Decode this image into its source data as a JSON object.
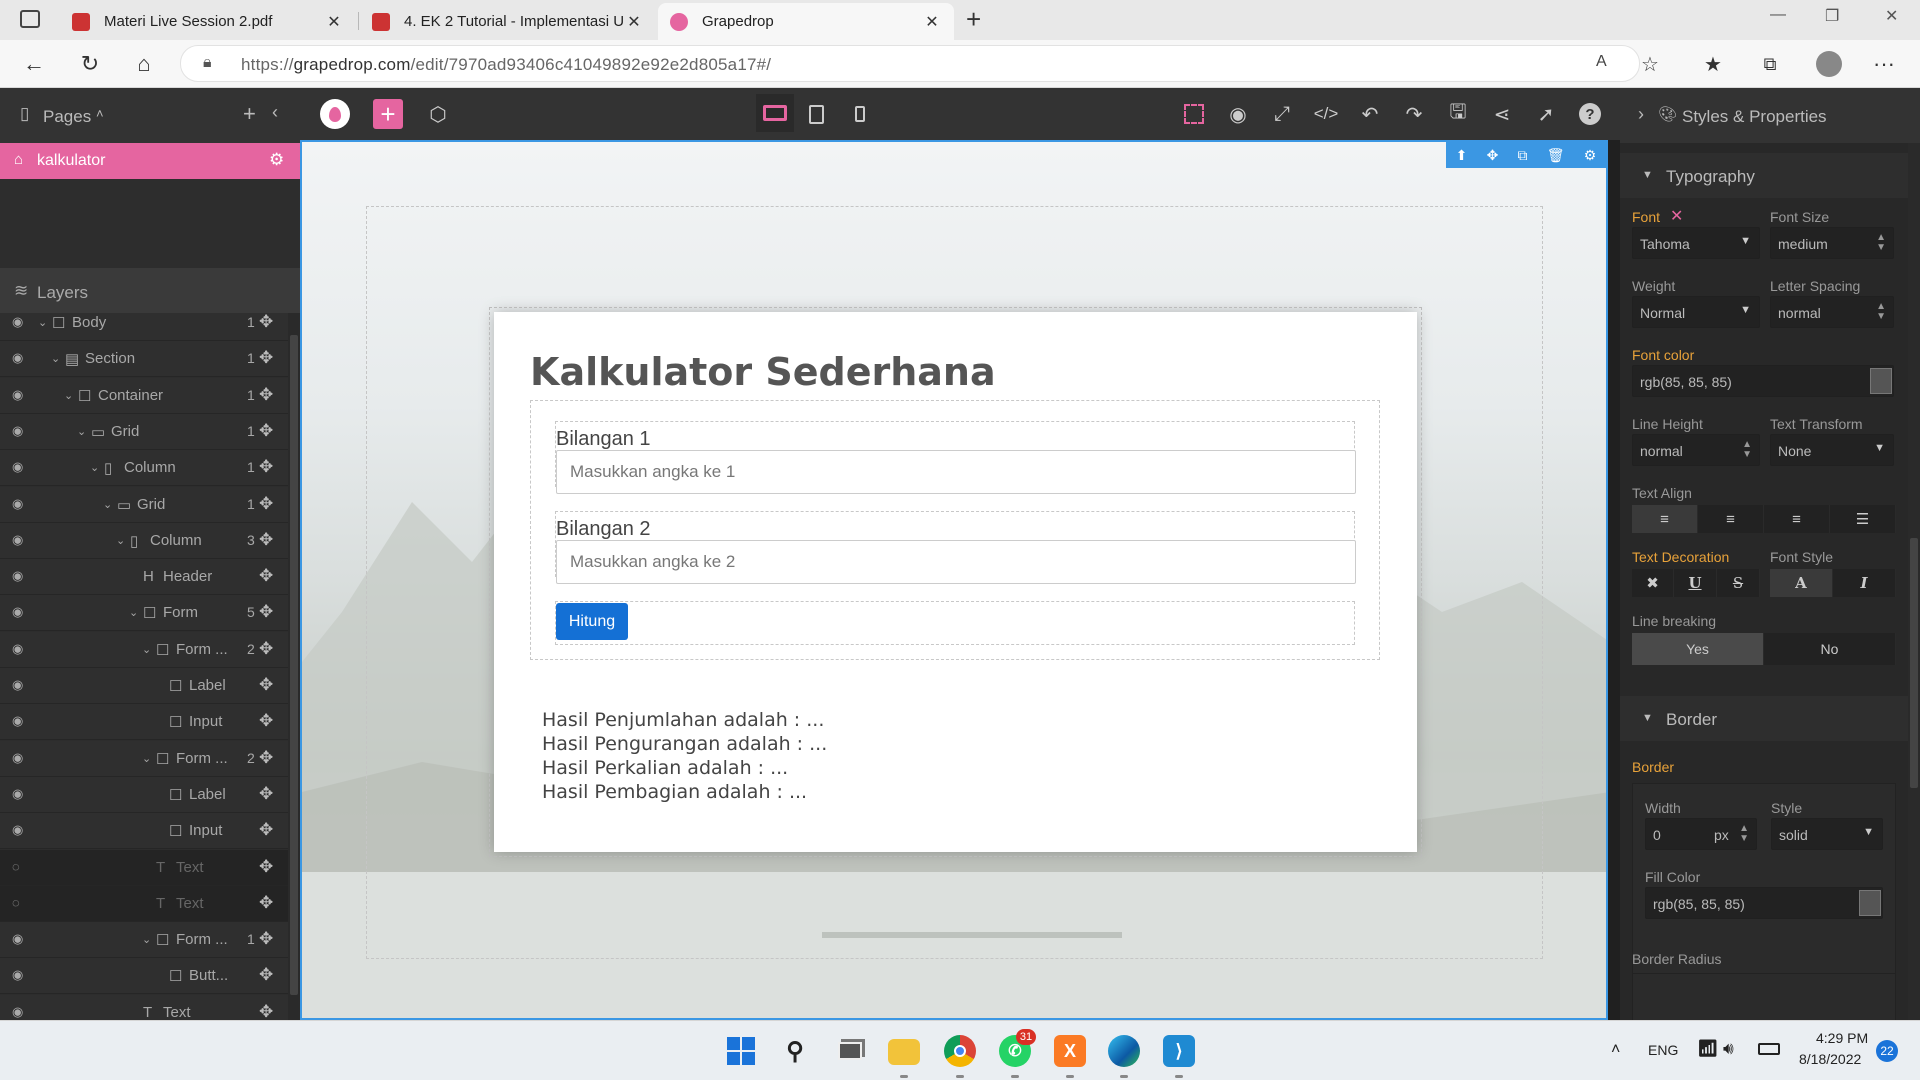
{
  "browser": {
    "tabs": [
      {
        "title": "Materi Live Session 2.pdf",
        "icon": "pdf-icon"
      },
      {
        "title": "4. EK 2 Tutorial - Implementasi U",
        "icon": "pdf-icon"
      },
      {
        "title": "Grapedrop",
        "icon": "grapedrop-icon"
      }
    ],
    "url_prefix": "https://",
    "url_host": "grapedrop.com",
    "url_path": "/edit/7970ad93406c41049892e92e2d805a17#/"
  },
  "left_panel": {
    "pages_label": "Pages",
    "page_name": "kalkulator",
    "layers_label": "Layers",
    "layers": [
      {
        "name": "Body",
        "count": "1",
        "indent": 0,
        "icon": "box-icon",
        "caret": true
      },
      {
        "name": "Section",
        "count": "1",
        "indent": 1,
        "icon": "section-icon",
        "caret": true
      },
      {
        "name": "Container",
        "count": "1",
        "indent": 2,
        "icon": "box-icon",
        "caret": true
      },
      {
        "name": "Grid",
        "count": "1",
        "indent": 3,
        "icon": "grid-icon",
        "caret": true
      },
      {
        "name": "Column",
        "count": "1",
        "indent": 4,
        "icon": "column-icon",
        "caret": true
      },
      {
        "name": "Grid",
        "count": "1",
        "indent": 5,
        "icon": "grid-icon",
        "caret": true
      },
      {
        "name": "Column",
        "count": "3",
        "indent": 6,
        "icon": "column-icon",
        "caret": true
      },
      {
        "name": "Header",
        "count": "",
        "indent": 7,
        "icon": "heading-icon",
        "caret": false
      },
      {
        "name": "Form",
        "count": "5",
        "indent": 7,
        "icon": "box-icon",
        "caret": true
      },
      {
        "name": "Form ...",
        "count": "2",
        "indent": 8,
        "icon": "box-icon",
        "caret": true
      },
      {
        "name": "Label",
        "count": "",
        "indent": 9,
        "icon": "box-icon",
        "caret": false
      },
      {
        "name": "Input",
        "count": "",
        "indent": 9,
        "icon": "box-icon",
        "caret": false
      },
      {
        "name": "Form ...",
        "count": "2",
        "indent": 8,
        "icon": "box-icon",
        "caret": true
      },
      {
        "name": "Label",
        "count": "",
        "indent": 9,
        "icon": "box-icon",
        "caret": false
      },
      {
        "name": "Input",
        "count": "",
        "indent": 9,
        "icon": "box-icon",
        "caret": false
      },
      {
        "name": "Text",
        "count": "",
        "indent": 8,
        "icon": "text-icon",
        "caret": false,
        "hidden": true
      },
      {
        "name": "Text",
        "count": "",
        "indent": 8,
        "icon": "text-icon",
        "caret": false,
        "hidden": true
      },
      {
        "name": "Form ...",
        "count": "1",
        "indent": 8,
        "icon": "box-icon",
        "caret": true
      },
      {
        "name": "Butt...",
        "count": "",
        "indent": 9,
        "icon": "box-icon",
        "caret": false
      },
      {
        "name": "Text",
        "count": "",
        "indent": 7,
        "icon": "text-icon",
        "caret": false
      }
    ]
  },
  "canvas": {
    "title": "Kalkulator Sederhana",
    "label1": "Bilangan 1",
    "placeholder1": "Masukkan angka ke 1",
    "label2": "Bilangan 2",
    "placeholder2": "Masukkan angka ke 2",
    "button": "Hitung",
    "results": [
      "Hasil Penjumlahan adalah : ...",
      "Hasil Pengurangan adalah : ...",
      "Hasil Perkalian adalah : ...",
      "Hasil Pembagian adalah : ..."
    ]
  },
  "right_panel": {
    "header": "Styles & Properties",
    "typography": {
      "title": "Typography",
      "font_label": "Font",
      "font_value": "Tahoma",
      "font_size_label": "Font Size",
      "font_size_value": "medium",
      "weight_label": "Weight",
      "weight_value": "Normal",
      "letter_spacing_label": "Letter Spacing",
      "letter_spacing_value": "normal",
      "font_color_label": "Font color",
      "font_color_value": "rgb(85, 85, 85)",
      "line_height_label": "Line Height",
      "line_height_value": "normal",
      "text_transform_label": "Text Transform",
      "text_transform_value": "None",
      "text_align_label": "Text Align",
      "text_decoration_label": "Text Decoration",
      "font_style_label": "Font Style",
      "line_breaking_label": "Line breaking",
      "line_breaking_yes": "Yes",
      "line_breaking_no": "No"
    },
    "border": {
      "title": "Border",
      "section_label": "Border",
      "width_label": "Width",
      "width_value": "0",
      "width_unit": "px",
      "style_label": "Style",
      "style_value": "solid",
      "fill_color_label": "Fill Color",
      "fill_color_value": "rgb(85, 85, 85)",
      "radius_label": "Border Radius"
    }
  },
  "taskbar": {
    "whatsapp_badge": "31",
    "language": "ENG",
    "time": "4:29 PM",
    "date": "8/18/2022",
    "notification_count": "22"
  },
  "colors": {
    "accent_pink": "#e565a0",
    "button_blue": "#1470d5",
    "selection_blue": "#3b97e3",
    "highlight_orange": "#e8a23a"
  }
}
